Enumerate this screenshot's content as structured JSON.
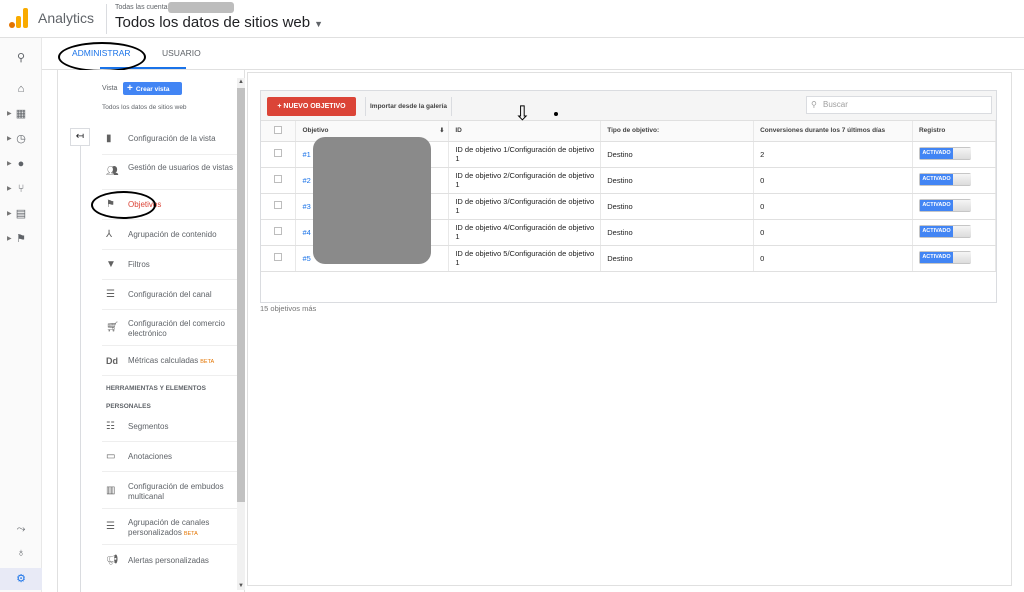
{
  "header": {
    "app_name": "Analytics",
    "account_line": "Todas las cuentas",
    "view_title": "Todos los datos de sitios web"
  },
  "tabs": {
    "admin": "ADMINISTRAR",
    "user": "USUARIO"
  },
  "admin": {
    "vista_label": "Vista",
    "create_view": "Crear vista",
    "all_data": "Todos los datos de sitios web",
    "menu": [
      {
        "label": "Configuración de la vista",
        "icon": "document-icon"
      },
      {
        "label": "Gestión de usuarios de vistas",
        "icon": "users-icon"
      },
      {
        "label": "Objetivos",
        "icon": "flag-icon"
      },
      {
        "label": "Agrupación de contenido",
        "icon": "content-grouping-icon"
      },
      {
        "label": "Filtros",
        "icon": "filter-icon"
      },
      {
        "label": "Configuración del canal",
        "icon": "channel-icon"
      },
      {
        "label": "Configuración del comercio electrónico",
        "icon": "cart-icon"
      },
      {
        "label": "Métricas calculadas",
        "badge": "BETA",
        "icon": "dd-icon"
      }
    ],
    "section_title_1": "HERRAMIENTAS Y ELEMENTOS",
    "section_title_2": "PERSONALES",
    "tools": [
      {
        "label": "Segmentos",
        "icon": "segments-icon"
      },
      {
        "label": "Anotaciones",
        "icon": "annotations-icon"
      },
      {
        "label": "Configuración de embudos multicanal",
        "icon": "bar-chart-icon"
      },
      {
        "label": "Agrupación de canales personalizados",
        "badge": "BETA",
        "icon": "channel-grouping-icon"
      },
      {
        "label": "Alertas personalizadas",
        "icon": "megaphone-icon"
      }
    ]
  },
  "goals": {
    "new_goal": "+ NUEVO OBJETIVO",
    "import": "Importar desde la galería",
    "search_placeholder": "Buscar",
    "columns": [
      "Objetivo",
      "ID",
      "Tipo de objetivo:",
      "Conversiones durante los 7 últimos días",
      "Registro"
    ],
    "rows": [
      {
        "goal": "#1",
        "id": "ID de objetivo 1/Configuración de objetivo 1",
        "type": "Destino",
        "conversions": "2",
        "status": "ACTIVADO"
      },
      {
        "goal": "#2",
        "id": "ID de objetivo 2/Configuración de objetivo 1",
        "type": "Destino",
        "conversions": "0",
        "status": "ACTIVADO"
      },
      {
        "goal": "#3",
        "id": "ID de objetivo 3/Configuración de objetivo 1",
        "type": "Destino",
        "conversions": "0",
        "status": "ACTIVADO"
      },
      {
        "goal": "#4",
        "id": "ID de objetivo 4/Configuración de objetivo 1",
        "type": "Destino",
        "conversions": "0",
        "status": "ACTIVADO"
      },
      {
        "goal": "#5",
        "id": "ID de objetivo 5/Configuración de objetivo 1",
        "type": "Destino",
        "conversions": "0",
        "status": "ACTIVADO"
      }
    ],
    "more": "15 objetivos más"
  },
  "colors": {
    "accent": "#1a73e8",
    "primary_button": "#db4437",
    "toggle_on": "#4285f4"
  }
}
